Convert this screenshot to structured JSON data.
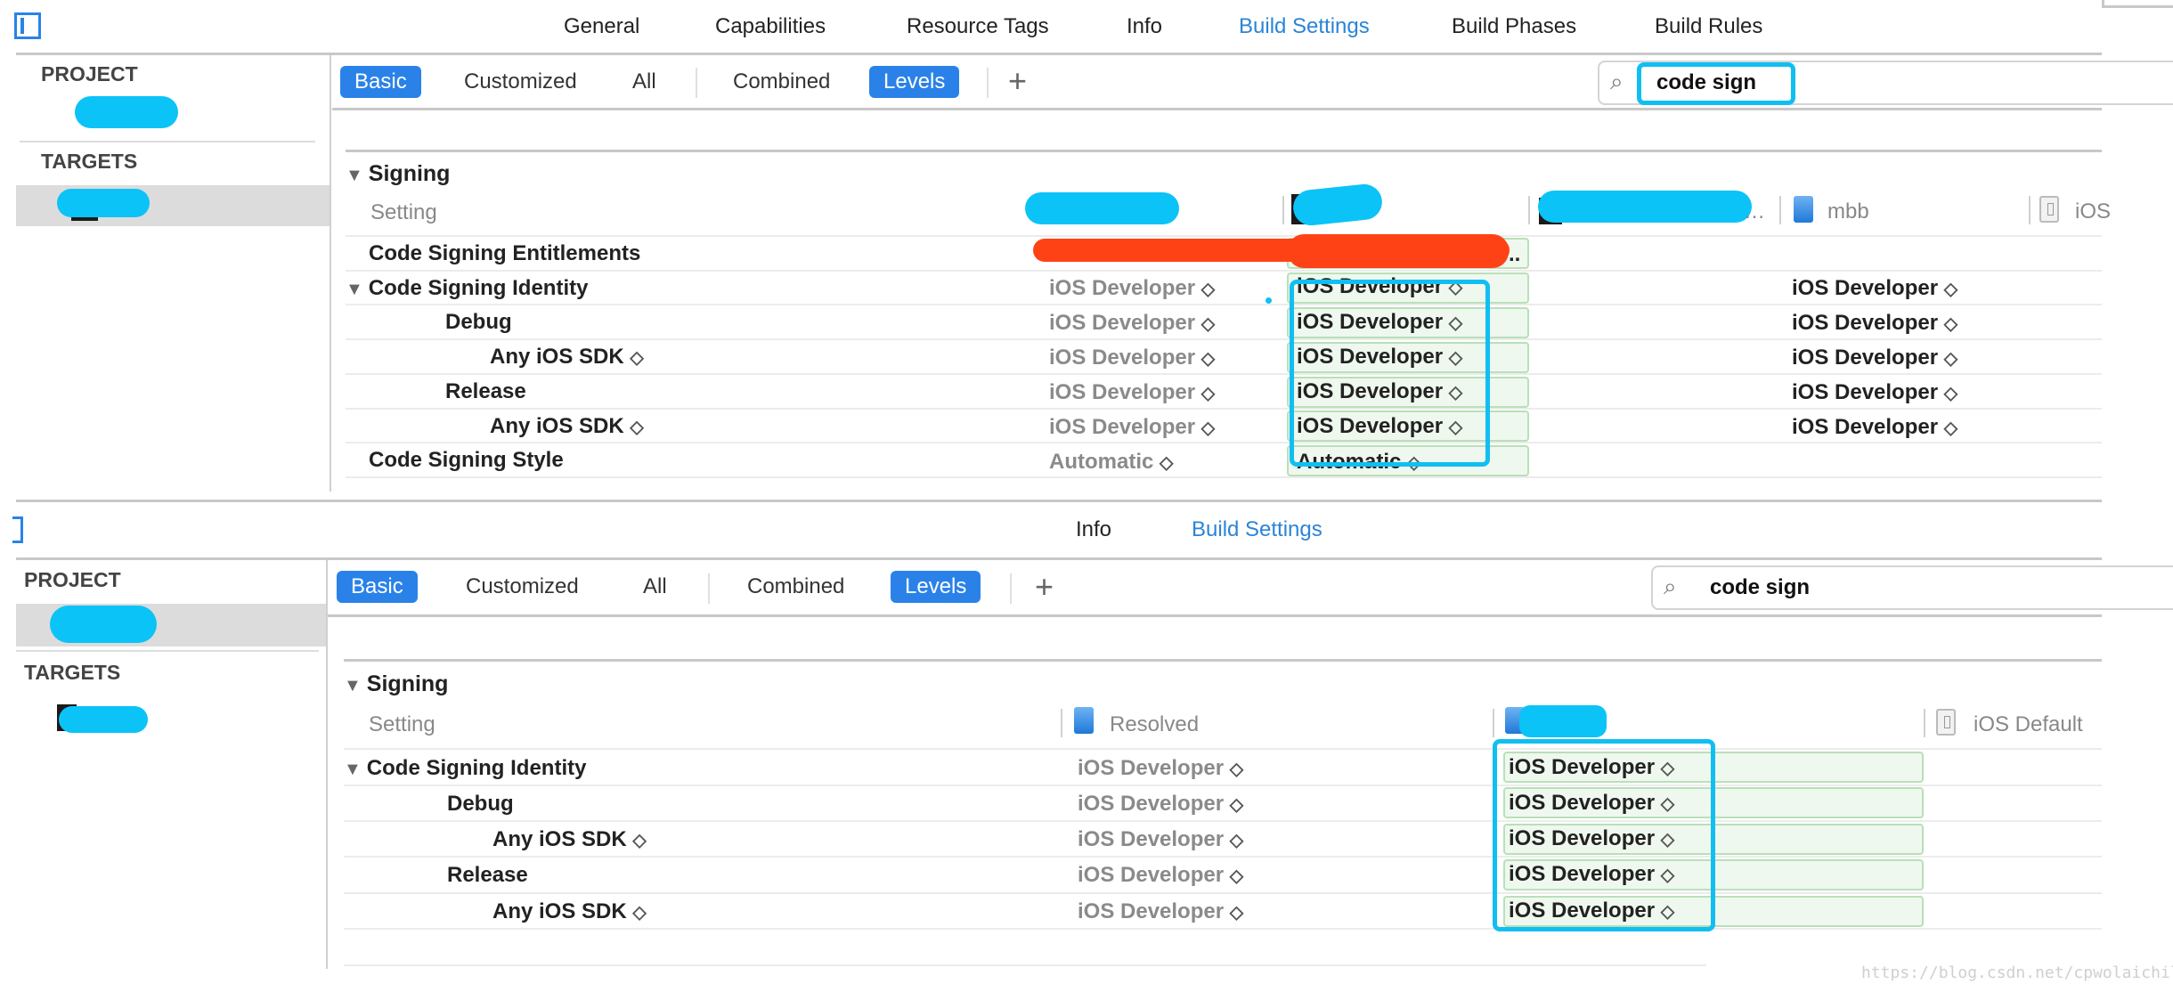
{
  "top": {
    "tabs": [
      {
        "label": "General",
        "active": false
      },
      {
        "label": "Capabilities",
        "active": false
      },
      {
        "label": "Resource Tags",
        "active": false
      },
      {
        "label": "Info",
        "active": false
      },
      {
        "label": "Build Settings",
        "active": true
      },
      {
        "label": "Build Phases",
        "active": false
      },
      {
        "label": "Build Rules",
        "active": false
      }
    ],
    "sidebar": {
      "project_header": "PROJECT",
      "targets_header": "TARGETS"
    },
    "filters": {
      "basic": "Basic",
      "customized": "Customized",
      "all": "All",
      "combined": "Combined",
      "levels": "Levels",
      "add": "+"
    },
    "search": {
      "value": "code sign"
    },
    "section_title": "Signing",
    "setting_header": "Setting",
    "column_headers": {
      "mbb": "mbb",
      "ios_default_truncated": "iOS"
    },
    "rows": [
      {
        "label": "Code Signing Entitlements",
        "resolved": "",
        "target": "",
        "project": ""
      },
      {
        "label": "Code Signing Identity",
        "resolved": "iOS Developer",
        "target": "iOS Developer",
        "project": "iOS Developer"
      },
      {
        "label": "Debug",
        "resolved": "iOS Developer",
        "target": "iOS Developer",
        "project": "iOS Developer"
      },
      {
        "label": "Any iOS SDK",
        "resolved": "iOS Developer",
        "target": "iOS Developer",
        "project": "iOS Developer"
      },
      {
        "label": "Release",
        "resolved": "iOS Developer",
        "target": "iOS Developer",
        "project": "iOS Developer"
      },
      {
        "label": "Any iOS SDK",
        "resolved": "iOS Developer",
        "target": "iOS Developer",
        "project": "iOS Developer"
      },
      {
        "label": "Code Signing Style",
        "resolved": "Automatic",
        "target": "Automatic",
        "project": ""
      }
    ]
  },
  "bottom": {
    "tabs": [
      {
        "label": "Info",
        "active": false
      },
      {
        "label": "Build Settings",
        "active": true
      }
    ],
    "sidebar": {
      "project_header": "PROJECT",
      "targets_header": "TARGETS"
    },
    "filters": {
      "basic": "Basic",
      "customized": "Customized",
      "all": "All",
      "combined": "Combined",
      "levels": "Levels",
      "add": "+"
    },
    "search": {
      "value": "code sign"
    },
    "section_title": "Signing",
    "setting_header": "Setting",
    "column_headers": {
      "resolved": "Resolved",
      "ios_default": "iOS Default"
    },
    "rows": [
      {
        "label": "Code Signing Identity",
        "resolved": "iOS Developer",
        "project": "iOS Developer"
      },
      {
        "label": "Debug",
        "resolved": "iOS Developer",
        "project": "iOS Developer"
      },
      {
        "label": "Any iOS SDK",
        "resolved": "iOS Developer",
        "project": "iOS Developer"
      },
      {
        "label": "Release",
        "resolved": "iOS Developer",
        "project": "iOS Developer"
      },
      {
        "label": "Any iOS SDK",
        "resolved": "iOS Developer",
        "project": "iOS Developer"
      }
    ]
  },
  "stepper_glyph": "◇",
  "watermark": "https://blog.csdn.net/cpwolaichile",
  "colors": {
    "accent": "#2a82e8",
    "active_tab": "#2b84d6",
    "highlight": "#10bff2",
    "redact_red": "#ff4215"
  }
}
